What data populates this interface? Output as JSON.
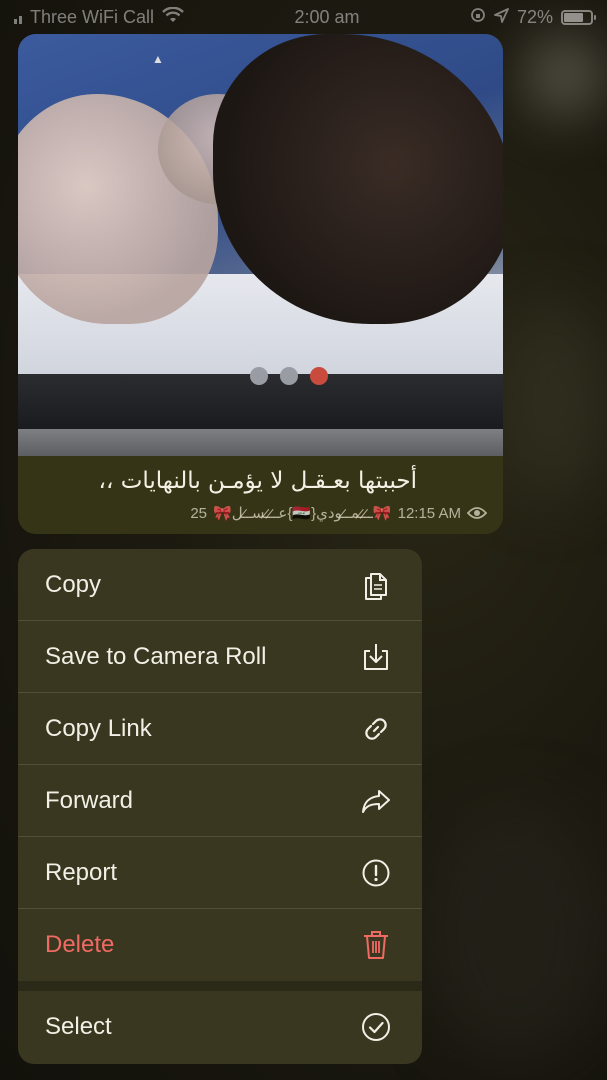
{
  "status_bar": {
    "carrier": "Three WiFi Call",
    "time": "2:00 am",
    "battery": "72%",
    "battery_level": 0.72
  },
  "message": {
    "caption": "أحببتها بعـقـل لا يؤمـن بالنهايات ،،",
    "views": "25",
    "author": "🎀عـ̷ـ̷ـسـ̷ـل{🇮🇶}ـ̷ـ̷ـمـ̷ـودي🎀",
    "time": "12:15 AM"
  },
  "menu": {
    "items": [
      {
        "label": "Copy",
        "icon": "copy-icon"
      },
      {
        "label": "Save to Camera Roll",
        "icon": "save-download-icon"
      },
      {
        "label": "Copy Link",
        "icon": "link-icon"
      },
      {
        "label": "Forward",
        "icon": "forward-icon"
      },
      {
        "label": "Report",
        "icon": "report-icon"
      },
      {
        "label": "Delete",
        "icon": "trash-icon"
      },
      {
        "label": "Select",
        "icon": "select-check-icon"
      }
    ]
  },
  "colors": {
    "menu_bg": "#39371f",
    "bubble_bg": "#363417",
    "danger": "#f06a64",
    "text": "#f2f0e6"
  }
}
